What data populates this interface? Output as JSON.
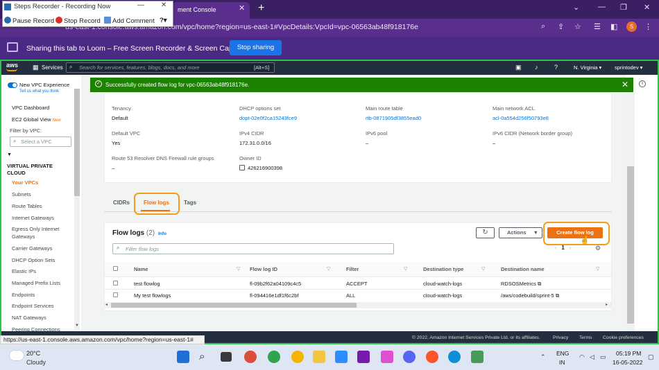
{
  "browser": {
    "tab_title": "ment Console",
    "tab_close": "✕",
    "new_tab": "+",
    "url": "us-east-1.console.aws.amazon.com/vpc/home?region=us-east-1#VpcDetails:VpcId=vpc-06563ab48f918176e",
    "avatar_letter": "S",
    "window_controls": [
      "⌄",
      "—",
      "❐",
      "✕"
    ]
  },
  "steps_recorder": {
    "title": "Steps Recorder - Recording Now",
    "pause_label": "Pause Record",
    "stop_label": "Stop Record",
    "add_comment_label": "Add Comment",
    "help_icon": "help-icon"
  },
  "loom": {
    "message": "Sharing this tab to Loom – Free Screen Recorder & Screen Capture",
    "stop_button": "Stop sharing"
  },
  "aws_header": {
    "logo": "aws",
    "services": "Services",
    "search_placeholder": "Search for services, features, blogs, docs, and more",
    "search_shortcut": "[Alt+S]",
    "region": "N. Virginia ▾",
    "account": "sprintodev ▾"
  },
  "sidebar": {
    "new_vpc_label": "New VPC Experience",
    "tell_us": "Tell us what you think",
    "items": [
      {
        "label": "VPC Dashboard"
      },
      {
        "label": "EC2 Global View",
        "badge": "New"
      },
      {
        "label": "Filter by VPC:"
      }
    ],
    "select_vpc_placeholder": "Select a VPC",
    "section_line1": "VIRTUAL PRIVATE",
    "section_line2": "CLOUD",
    "links": [
      "Your VPCs",
      "Subnets",
      "Route Tables",
      "Internet Gateways",
      "Egress Only Internet",
      "Gateways",
      "Carrier Gateways",
      "DHCP Option Sets",
      "Elastic IPs",
      "Managed Prefix Lists",
      "Endpoints",
      "Endpoint Services",
      "NAT Gateways",
      "Peering Connections"
    ]
  },
  "flash": {
    "message": "Successfully created flow log for vpc-06563ab48f918176e."
  },
  "details": {
    "tenancy_label": "Tenancy",
    "tenancy_value": "Default",
    "dhcp_label": "DHCP options set",
    "dhcp_value": "dopt-02e0f2ca15243fce9",
    "main_route_label": "Main route table",
    "main_route_value": "rtb-0871905df3855ead0",
    "main_acl_label": "Main network ACL",
    "main_acl_value": "acl-0a554d256f50793e8",
    "default_vpc_label": "Default VPC",
    "default_vpc_value": "Yes",
    "ipv4_label": "IPv4 CIDR",
    "ipv4_value": "172.31.0.0/16",
    "ipv6_pool_label": "IPv6 pool",
    "ipv6_pool_value": "–",
    "ipv6_cidr_label": "IPv6 CIDR (Network border group)",
    "ipv6_cidr_value": "–",
    "resolver_label": "Route 53 Resolver DNS Firewall rule groups",
    "resolver_value": "–",
    "owner_label": "Owner ID",
    "owner_value": "426216900398"
  },
  "tabs": [
    "CIDRs",
    "Flow logs",
    "Tags"
  ],
  "flow_logs": {
    "title": "Flow logs",
    "count": "(2)",
    "info": "Info",
    "actions": "Actions",
    "create_button": "Create flow log",
    "filter_placeholder": "Filter flow logs",
    "page": "1",
    "columns": [
      "Name",
      "Flow log ID",
      "Filter",
      "Destination type",
      "Destination name"
    ],
    "rows": [
      {
        "name": "test flowlog",
        "id": "fl-09b2f62a04109c4c5",
        "filter": "ACCEPT",
        "dest_type": "cloud-watch-logs",
        "dest_name": "RDSOSMetrics"
      },
      {
        "name": "My test flowlogs",
        "id": "fl-094416e1df1f6c2bf",
        "filter": "ALL",
        "dest_type": "cloud-watch-logs",
        "dest_name": "/aws/codebuild/sprint-5"
      }
    ]
  },
  "footer": {
    "copyright": "© 2022, Amazon Internet Services Private Ltd. or its affiliates.",
    "privacy": "Privacy",
    "terms": "Terms",
    "cookies": "Cookie preferences",
    "status_url": "https://us-east-1.console.aws.amazon.com/vpc/home?region=us-east-1#"
  },
  "taskbar": {
    "temperature": "20°C",
    "condition": "Cloudy",
    "lang1": "ENG",
    "lang2": "IN",
    "time": "05:19 PM",
    "date": "16-05-2022",
    "apps": [
      "windows-icon",
      "search-icon",
      "task-view-icon",
      "chrome-icon",
      "chrome-alt-icon",
      "chrome-profile-icon",
      "file-explorer-icon",
      "zoom-icon",
      "onenote-icon",
      "power-automate-icon",
      "discord-icon",
      "brave-icon",
      "edge-icon",
      "snip-icon"
    ]
  },
  "colors": {
    "aws_orange": "#ec7211",
    "aws_nav": "#232f3e",
    "success_green": "#1d8102",
    "link_blue": "#0972d3",
    "highlight_orange": "#f59c1a",
    "frame_green": "#31c44a"
  }
}
